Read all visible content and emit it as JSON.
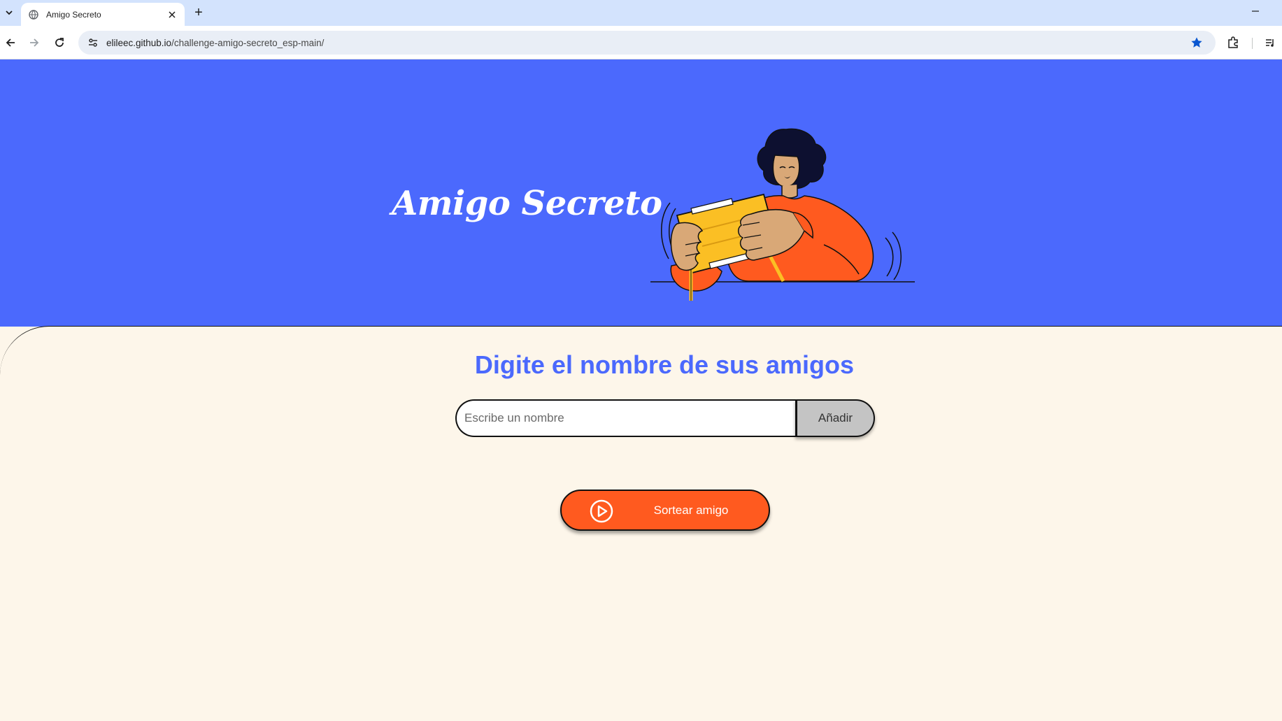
{
  "browser": {
    "tab_title": "Amigo Secreto",
    "new_tab_symbol": "+",
    "url_host": "elileec.github.io",
    "url_path": "/challenge-amigo-secreto_esp-main/"
  },
  "hero": {
    "title": "Amigo Secreto"
  },
  "main": {
    "section_title": "Digite el nombre de sus amigos",
    "name_input": {
      "value": "",
      "placeholder": "Escribe un nombre"
    },
    "add_button_label": "Añadir",
    "draw_button_label": "Sortear amigo",
    "friends": [],
    "result": []
  },
  "colors": {
    "hero_bg": "#4b69fd",
    "page_bg": "#fdf6ea",
    "accent_orange": "#ff5a1f",
    "title_blue": "#4b69fd",
    "add_button_bg": "#c4c4c4"
  },
  "icons": [
    "tab-search-icon",
    "globe-icon",
    "close-icon",
    "back-arrow-icon",
    "forward-arrow-icon",
    "reload-icon",
    "site-info-icon",
    "bookmark-star-icon",
    "extensions-icon",
    "media-control-icon",
    "play-circle-icon"
  ]
}
